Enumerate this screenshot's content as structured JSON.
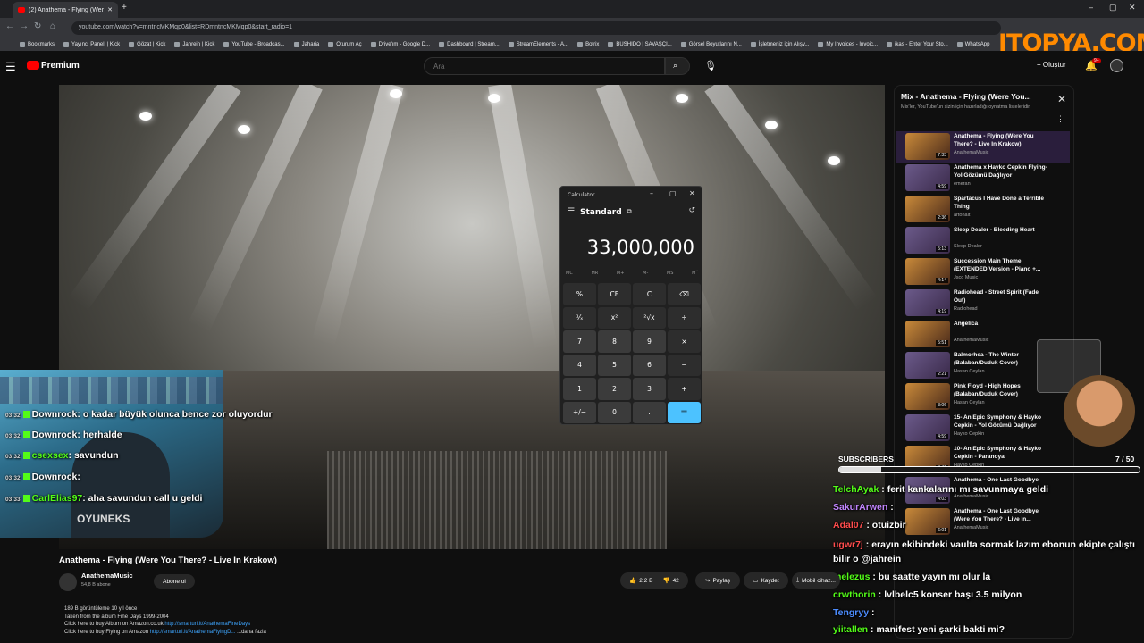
{
  "browser": {
    "tab_title": "(2) Anathema - Flying (Were Y...",
    "url": "youtube.com/watch?v=mntncMKMqp0&list=RDmntncMKMqp0&start_radio=1"
  },
  "bookmarks": [
    "Bookmarks",
    "Yayıncı Paneli | Kick",
    "Gözat | Kick",
    "Jahrein | Kick",
    "YouTube - Broadcas...",
    "Jaharia",
    "Oturum Aç",
    "Drive'ım - Google D...",
    "Dashboard | Stream...",
    "StreamElements - A...",
    "Botrix",
    "BUSHIDO | SAVAŞÇI...",
    "Görsel Boyutlarını N...",
    "İşletmeniz için Alışv...",
    "My Invoices - Invoic...",
    "ikas - Enter Your Sto...",
    "WhatsApp"
  ],
  "watermark": "ITOPYA.COM",
  "youtube": {
    "logo": "Premium",
    "search_placeholder": "Ara",
    "create_label": "Oluştur",
    "notif_count": "9+"
  },
  "calculator": {
    "title": "Calculator",
    "mode": "Standard",
    "display": "33,000,000",
    "memory": [
      "MC",
      "MR",
      "M+",
      "M-",
      "MS",
      "M˅"
    ],
    "keys": [
      "%",
      "CE",
      "C",
      "⌫",
      "¹⁄ₓ",
      "x²",
      "²√x",
      "÷",
      "7",
      "8",
      "9",
      "×",
      "4",
      "5",
      "6",
      "−",
      "1",
      "2",
      "3",
      "+",
      "+/−",
      "0",
      ".",
      "="
    ]
  },
  "chat": [
    {
      "time": "03:32",
      "user": "Downrock",
      "msg": "o kadar büyük olunca bence zor oluyordur",
      "color": "#ffffff"
    },
    {
      "time": "03:32",
      "user": "Downrock",
      "msg": "herhalde",
      "color": "#ffffff"
    },
    {
      "time": "03:32",
      "user": "csexsex",
      "msg": "savundun",
      "color": "#53fc18"
    },
    {
      "time": "03:32",
      "user": "Downrock",
      "msg": "",
      "color": "#ffffff"
    },
    {
      "time": "03:33",
      "user": "CarlElias97",
      "msg": "aha savundun call u geldi",
      "color": "#53fc18"
    }
  ],
  "chat_right": [
    {
      "user": "TelchAyak",
      "msg": "ferit kankalarını mı savunmaya geldi",
      "color": "#53fc18"
    },
    {
      "user": "SakurArwen",
      "msg": "",
      "color": "#c084fc"
    },
    {
      "user": "Adal07",
      "msg": "otuizbir",
      "color": "#ff4d4d"
    },
    {
      "user": "ugwr7j",
      "msg": "erayın ekibindeki vaulta sormak lazım ebonun ekipte çalıştı bilir o @jahrein",
      "color": "#ff4d4d"
    },
    {
      "user": "melezus",
      "msg": "bu saatte yayın mı olur la",
      "color": "#53fc18"
    },
    {
      "user": "crwthorin",
      "msg": "lvlbelc5 konser başı 3.5 milyon",
      "color": "#53fc18"
    },
    {
      "user": "Tengryy",
      "msg": "",
      "color": "#4d8dff"
    },
    {
      "user": "yiitallen",
      "msg": "manifest yeni şarki bakti mi?",
      "color": "#53fc18"
    }
  ],
  "playlist": {
    "title": "Mix - Anathema - Flying (Were You...",
    "subtitle": "Mix'ler, YouTube'un sizin için hazırladığı oynatma listeleridir",
    "items": [
      {
        "title": "Anathema - Flying (Were You There? - Live In Krakow)",
        "channel": "AnathemaMusic",
        "duration": "7:33"
      },
      {
        "title": "Anathema x Hayko Cepkin Flying-Yol Gözümü Dağlıyor",
        "channel": "emeran",
        "duration": "4:59"
      },
      {
        "title": "Spartacus I Have Done a Terrible Thing",
        "channel": "artonalt",
        "duration": "2:36"
      },
      {
        "title": "Sleep Dealer - Bleeding Heart",
        "channel": "Sleep Dealer",
        "duration": "5:13"
      },
      {
        "title": "Succession Main Theme (EXTENDED Version - Piano +...",
        "channel": "Jsco Music",
        "duration": "4:14"
      },
      {
        "title": "Radiohead - Street Spirit (Fade Out)",
        "channel": "Radiohead",
        "duration": "4:19"
      },
      {
        "title": "Angelica",
        "channel": "AnathemaMusic",
        "duration": "5:51"
      },
      {
        "title": "Balmorhea - The Winter (Balaban/Duduk Cover)",
        "channel": "Hasan Ceylan",
        "duration": "2:21"
      },
      {
        "title": "Pink Floyd - High Hopes (Balaban/Duduk Cover)",
        "channel": "Hasan Ceylan",
        "duration": "3:06"
      },
      {
        "title": "15- An Epic Symphony & Hayko Cepkin - Yol Gözümü Dağlıyor",
        "channel": "Hayko Cepkin",
        "duration": "4:59"
      },
      {
        "title": "10- An Epic Symphony & Hayko Cepkin - Paranoya",
        "channel": "Hayko Cepkin",
        "duration": "4:46"
      },
      {
        "title": "Anathema - One Last Goodbye",
        "channel": "AnathemaMusic",
        "duration": "4:03"
      },
      {
        "title": "Anathema - One Last Goodbye (Were You There? - Live In...",
        "channel": "AnathemaMusic",
        "duration": "6:01"
      }
    ]
  },
  "subscribers": {
    "label": "SUBSCRIBERS",
    "count": "7 / 50",
    "fraction": 0.14
  },
  "video": {
    "title": "Anathema - Flying (Were You There? - Live In Krakow)",
    "channel": "AnathemaMusic",
    "channel_subs": "54,8 B abone",
    "subscribe": "Abone ol",
    "likes": "2,2 B",
    "dislikes": "42",
    "share": "Paylaş",
    "save": "Kaydet",
    "download": "Mobil cihaz..."
  },
  "description": {
    "views": "189 B görüntüleme  10 yıl önce",
    "line2": "Taken from the album Fine Days 1999-2004",
    "line3": "Click here to buy Album on Amazon.co.uk",
    "link1": "http://smarturl.it/AnathemaFineDays",
    "line4": "Click here to buy Flying on Amazon",
    "link2": "http://smarturl.it/AnathemaFlyingD...",
    "more": "...daha fazla"
  }
}
